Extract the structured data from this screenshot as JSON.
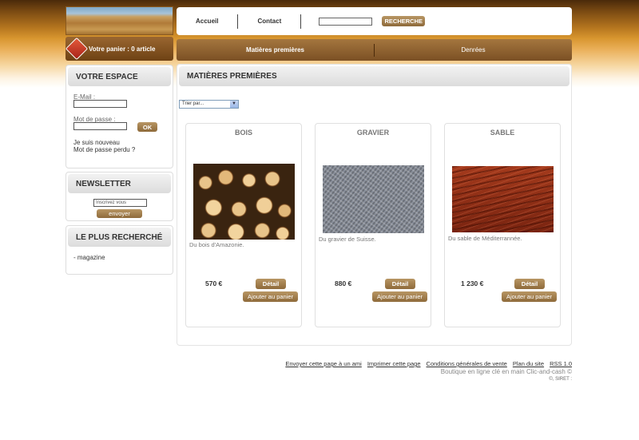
{
  "header": {
    "cart_summary": "Votre panier : 0 article"
  },
  "top_menu": {
    "home": "Accueil",
    "contact": "Contact",
    "search_value": "",
    "search_button": "RECHERCHE"
  },
  "category_tabs": {
    "items": [
      "Matières premières",
      "Denrées"
    ]
  },
  "account": {
    "title": "VOTRE ESPACE",
    "email_label": "E-Mail :",
    "password_label": "Mot de passe :",
    "ok_button": "OK",
    "new_user_link": "Je suis nouveau",
    "lost_password_link": "Mot de passe perdu ?"
  },
  "newsletter": {
    "title": "NEWSLETTER",
    "input_value": "Inscrivez vous",
    "send_button": "envoyer"
  },
  "popular": {
    "title": "LE PLUS RECHERCHÉ",
    "items": [
      "- magazine"
    ]
  },
  "main": {
    "title": "MATIÈRES PREMIÈRES",
    "sort_selected": "Trier par...",
    "products": [
      {
        "name": "BOIS",
        "description": "Du bois d'Amazonie.",
        "price": "570 €",
        "detail_label": "Détail",
        "add_label": "Ajouter au panier"
      },
      {
        "name": "GRAVIER",
        "description": "Du gravier de Suisse.",
        "price": "880 €",
        "detail_label": "Détail",
        "add_label": "Ajouter au panier"
      },
      {
        "name": "SABLE",
        "description": "Du sable de Méditerrannée.",
        "price": "1 230 €",
        "detail_label": "Détail",
        "add_label": "Ajouter au panier"
      }
    ]
  },
  "footer": {
    "links": [
      "Envoyer cette page à un ami",
      "Imprimer cette page",
      "Conditions générales de vente",
      "Plan du site",
      "RSS 1.0"
    ],
    "credit": "Boutique en ligne clé en main Clic-and-cash ©",
    "legal": "©, SIRET :"
  }
}
